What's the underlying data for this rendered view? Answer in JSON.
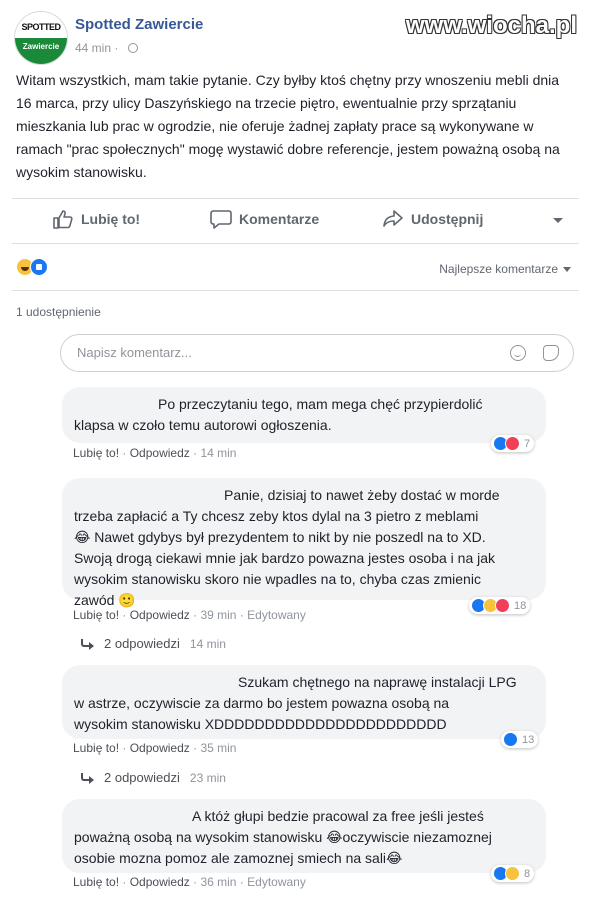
{
  "post": {
    "avatar_top": "SPOTTED",
    "avatar_bottom": "Zawiercie",
    "page_name": "Spotted Zawiercie",
    "time": "44 min ·",
    "watermark": "www.wiocha.pl",
    "text": "Witam wszystkich, mam takie pytanie. Czy byłby ktoś chętny przy wnoszeniu mebli dnia 16 marca, przy ulicy Daszyńskiego na trzecie piętro, ewentualnie przy sprzątaniu mieszkania lub prac w ogrodzie, nie oferuje żadnej zapłaty prace są wykonywane w ramach \"prac społecznych\" mogę wystawić dobre referencje, jestem poważną osobą na wysokim stanowisku."
  },
  "actions": {
    "like": "Lubię to!",
    "comment": "Komentarze",
    "share": "Udostępnij"
  },
  "reactions_summary": {
    "icons": [
      "haha",
      "like"
    ]
  },
  "sort_label": "Najlepsze komentarze",
  "shares": "1 udostępnienie",
  "comment_box": {
    "placeholder": "Napisz komentarz..."
  },
  "comments": [
    {
      "lines": [
        "Po przeczytaniu tego, mam mega chęć przypierdolić",
        "klapsa w czoło temu autorowi ogłoszenia."
      ],
      "like": "Lubię to!",
      "reply": "Odpowiedz",
      "time": "14 min",
      "edited": "",
      "reactions": [
        "like",
        "love"
      ],
      "count": "7"
    },
    {
      "lines": [
        "Panie, dzisiaj to nawet żeby dostać w morde",
        "trzeba zapłacić a Ty chcesz zeby ktos dylal na 3 pietro z meblami",
        "😂 Nawet gdybys był prezydentem to nikt by nie poszedl na to XD.",
        "Swoją drogą ciekawi mnie jak bardzo powazna jestes osoba i na jak",
        "wysokim stanowisku skoro nie wpadles na to, chyba czas zmienic",
        "zawód 🙂"
      ],
      "like": "Lubię to!",
      "reply": "Odpowiedz",
      "time": "39 min",
      "edited": "Edytowany",
      "reactions": [
        "like",
        "haha",
        "love"
      ],
      "count": "18",
      "replies": {
        "label": "2 odpowiedzi",
        "time": "14 min"
      }
    },
    {
      "lines": [
        "Szukam chętnego na naprawę instalacji LPG",
        "w astrze, oczywiscie za darmo bo jestem powazna osobą na",
        "wysokim stanowisku XDDDDDDDDDDDDDDDDDDDDDDD"
      ],
      "like": "Lubię to!",
      "reply": "Odpowiedz",
      "time": "35 min",
      "edited": "",
      "reactions": [
        "like"
      ],
      "count": "13",
      "replies": {
        "label": "2 odpowiedzi",
        "time": "23 min"
      }
    },
    {
      "lines": [
        "A któż głupi bedzie pracowal za free jeśli jesteś",
        "poważną osobą na wysokim stanowisku 😂oczywiscie niezamoznej",
        "osobie mozna pomoz ale zamoznej smiech na sali😂"
      ],
      "like": "Lubię to!",
      "reply": "Odpowiedz",
      "time": "36 min",
      "edited": "Edytowany",
      "reactions": [
        "like",
        "haha"
      ],
      "count": "8"
    }
  ]
}
